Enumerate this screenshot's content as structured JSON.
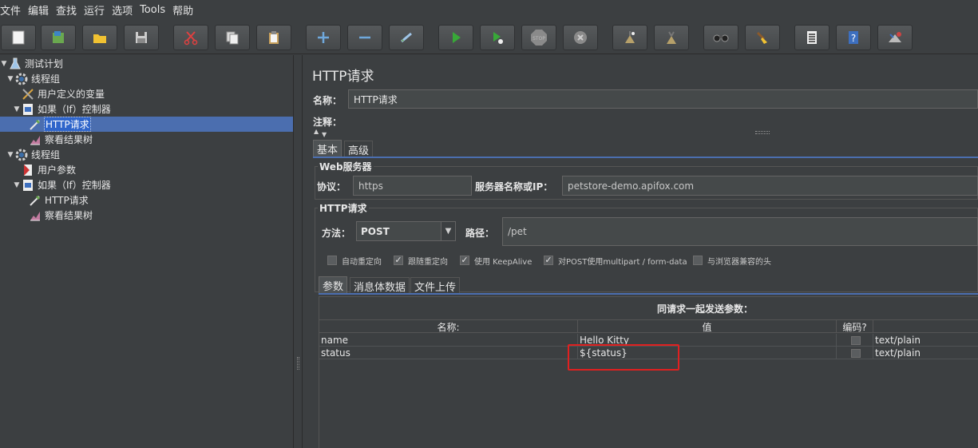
{
  "menu": [
    "文件",
    "编辑",
    "查找",
    "运行",
    "选项",
    "Tools",
    "帮助"
  ],
  "toolbar_icons": [
    "new-icon",
    "templates-icon",
    "open-icon",
    "save-icon",
    "cut-icon",
    "copy-icon",
    "paste-icon",
    "expand-icon",
    "collapse-icon",
    "toggle-icon",
    "start-icon",
    "start-no-timers-icon",
    "stop-icon",
    "shutdown-icon",
    "clear-icon",
    "clear-all-icon",
    "search-icon",
    "reset-search-icon",
    "function-helper-icon",
    "help-icon",
    "remote-icon"
  ],
  "tree": [
    {
      "label": "测试计划",
      "icon": "test-plan-icon",
      "arrow": "▼"
    },
    {
      "label": "线程组",
      "icon": "thread-group-icon",
      "arrow": "▼"
    },
    {
      "label": "用户定义的变量",
      "icon": "config-icon",
      "arrow": ""
    },
    {
      "label": "如果（If）控制器",
      "icon": "if-controller-icon",
      "arrow": "▼"
    },
    {
      "label": "HTTP请求",
      "icon": "sampler-icon",
      "arrow": ""
    },
    {
      "label": "察看结果树",
      "icon": "listener-icon",
      "arrow": ""
    },
    {
      "label": "线程组",
      "icon": "thread-group-icon",
      "arrow": "▼"
    },
    {
      "label": "用户参数",
      "icon": "preprocessor-icon",
      "arrow": ""
    },
    {
      "label": "如果（If）控制器",
      "icon": "if-controller-icon",
      "arrow": "▼"
    },
    {
      "label": "HTTP请求",
      "icon": "sampler-icon",
      "arrow": ""
    },
    {
      "label": "察看结果树",
      "icon": "listener-icon",
      "arrow": ""
    }
  ],
  "panel": {
    "title": "HTTP请求",
    "name_label": "名称：",
    "name_value": "HTTP请求",
    "comment_label": "注释：",
    "comment_value": "",
    "tabs": [
      "基本",
      "高级"
    ],
    "web_server_title": "Web服务器",
    "protocol_label": "协议：",
    "protocol_value": "https",
    "server_label": "服务器名称或IP：",
    "server_value": "petstore-demo.apifox.com",
    "http_request_title": "HTTP请求",
    "method_label": "方法：",
    "method_value": "POST",
    "path_label": "路径：",
    "path_value": "/pet",
    "checkboxes": [
      {
        "label": "自动重定向",
        "checked": false
      },
      {
        "label": "跟随重定向",
        "checked": true
      },
      {
        "label": "使用 KeepAlive",
        "checked": true
      },
      {
        "label": "对POST使用multipart / form-data",
        "checked": true
      },
      {
        "label": "与浏览器兼容的头",
        "checked": false
      }
    ],
    "sub_tabs": [
      "参数",
      "消息体数据",
      "文件上传"
    ],
    "params_caption": "同请求一起发送参数：",
    "columns": [
      "名称:",
      "值",
      "编码?",
      ""
    ],
    "rows": [
      {
        "name": "name",
        "value": "Hello Kitty",
        "encode": false,
        "content_type": "text/plain"
      },
      {
        "name": "status",
        "value": "${status}",
        "encode": false,
        "content_type": "text/plain"
      }
    ]
  }
}
